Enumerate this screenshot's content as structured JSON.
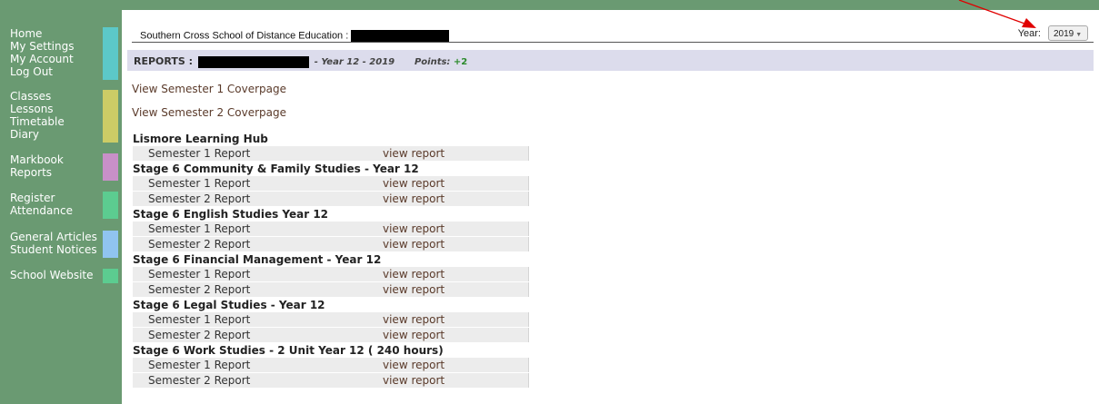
{
  "sidebar": {
    "groups": [
      {
        "color": "#5cc8c8",
        "items": [
          {
            "label": "Home"
          },
          {
            "label": "My Settings"
          },
          {
            "label": "My Account"
          },
          {
            "label": "Log Out"
          }
        ]
      },
      {
        "color": "#cccc66",
        "items": [
          {
            "label": "Classes"
          },
          {
            "label": "Lessons"
          },
          {
            "label": "Timetable"
          },
          {
            "label": "Diary"
          }
        ]
      },
      {
        "color": "#c890c8",
        "items": [
          {
            "label": "Markbook"
          },
          {
            "label": "Reports"
          }
        ]
      },
      {
        "color": "#5ccc90",
        "items": [
          {
            "label": "Register"
          },
          {
            "label": "Attendance"
          }
        ]
      },
      {
        "color": "#90c4f0",
        "items": [
          {
            "label": "General Articles"
          },
          {
            "label": "Student Notices"
          }
        ]
      },
      {
        "color": "#5ccc90",
        "items": [
          {
            "label": "School Website"
          }
        ]
      }
    ]
  },
  "header": {
    "school_name": "Southern Cross School of Distance Education :",
    "year_label": "Year:",
    "year_value": "2019"
  },
  "banner": {
    "title": "REPORTS :",
    "year_text": "- Year 12 - 2019",
    "points_label": "Points:",
    "points_value": "+2"
  },
  "links": {
    "semester1_cover": "View Semester 1 Coverpage",
    "semester2_cover": "View Semester 2 Coverpage"
  },
  "courses": [
    {
      "name": "Lismore Learning Hub",
      "reports": [
        {
          "label": "Semester 1 Report",
          "link": "view report"
        }
      ]
    },
    {
      "name": "Stage 6 Community & Family Studies - Year 12",
      "reports": [
        {
          "label": "Semester 1 Report",
          "link": "view report"
        },
        {
          "label": "Semester 2 Report",
          "link": "view report"
        }
      ]
    },
    {
      "name": "Stage 6 English Studies Year 12",
      "reports": [
        {
          "label": "Semester 1 Report",
          "link": "view report"
        },
        {
          "label": "Semester 2 Report",
          "link": "view report"
        }
      ]
    },
    {
      "name": "Stage 6 Financial Management - Year 12",
      "reports": [
        {
          "label": "Semester 1 Report",
          "link": "view report"
        },
        {
          "label": "Semester 2 Report",
          "link": "view report"
        }
      ]
    },
    {
      "name": "Stage 6 Legal Studies - Year 12",
      "reports": [
        {
          "label": "Semester 1 Report",
          "link": "view report"
        },
        {
          "label": "Semester 2 Report",
          "link": "view report"
        }
      ]
    },
    {
      "name": "Stage 6 Work Studies - 2 Unit Year 12 ( 240 hours)",
      "reports": [
        {
          "label": "Semester 1 Report",
          "link": "view report"
        },
        {
          "label": "Semester 2 Report",
          "link": "view report"
        }
      ]
    }
  ],
  "colors": {
    "sidebar_bg": "#6a9a72",
    "banner_bg": "#dcdcec",
    "annotation_arrow": "#e00000"
  }
}
